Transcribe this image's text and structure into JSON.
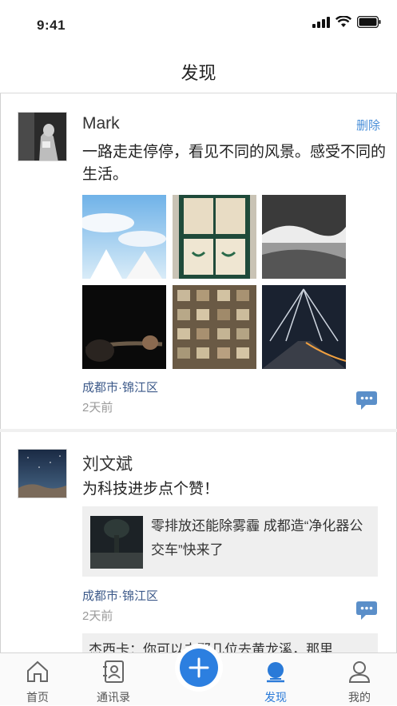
{
  "status": {
    "time": "9:41"
  },
  "header": {
    "title": "发现"
  },
  "posts": [
    {
      "author": "Mark",
      "delete_label": "删除",
      "text": "一路走走停停，看见不同的风景。感受不同的生活。",
      "location": "成都市·锦江区",
      "time": "2天前"
    },
    {
      "author": "刘文斌",
      "text": "为科技进步点个赞！",
      "link_title": "零排放还能除雾霾 成都造“净化器公交车”快来了",
      "location": "成都市·锦江区",
      "time": "2天前",
      "comment_preview": "杰西卡：你可以去那几位去黄龙溪，那里"
    }
  ],
  "tabs": [
    {
      "label": "首页",
      "icon": "home-icon"
    },
    {
      "label": "通讯录",
      "icon": "contacts-icon"
    },
    {
      "label": "发现",
      "icon": "discover-icon",
      "active": true
    },
    {
      "label": "我的",
      "icon": "profile-icon"
    }
  ],
  "colors": {
    "accent": "#2c7fe0",
    "location": "#3d5a8a",
    "delete": "#4a8fd8"
  }
}
